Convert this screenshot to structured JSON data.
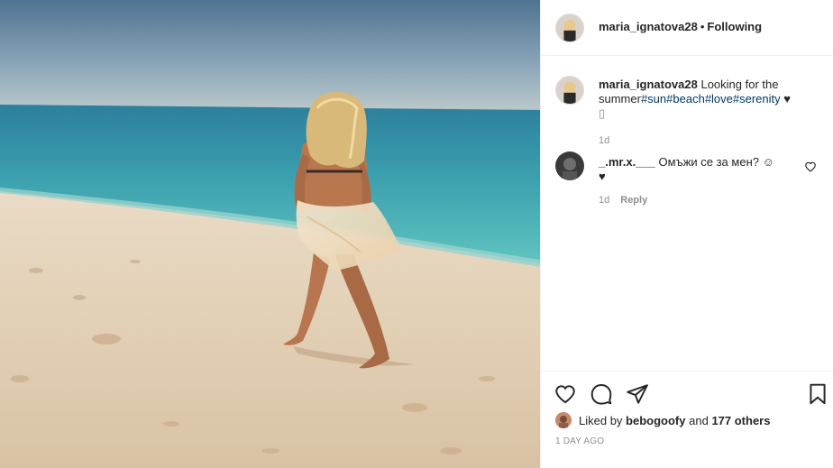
{
  "colors": {
    "text": "#262626",
    "muted": "#8e8e8e",
    "hashtag": "#00376b",
    "border": "#efefef"
  },
  "post": {
    "photo_icon": "beach-photo",
    "header": {
      "username": "maria_ignatova28",
      "separator": "•",
      "follow_status": "Following"
    },
    "caption": {
      "username": "maria_ignatova28",
      "text": "Looking for the summer",
      "hashtags": [
        "#sun",
        "#beach",
        "#love",
        "#serenity"
      ],
      "trailing": "♥",
      "trailing_box": "▯",
      "time": "1d"
    },
    "comments": [
      {
        "username": "_.mr.x.___",
        "text": "Омъжи се за мен? ☺",
        "heart": "♥",
        "time": "1d",
        "reply_label": "Reply",
        "like_icon": "heart-outline-icon"
      }
    ],
    "actions": {
      "like_icon": "heart-outline-icon",
      "comment_icon": "comment-icon",
      "share_icon": "share-icon",
      "save_icon": "bookmark-icon"
    },
    "likes": {
      "prefix": "Liked by",
      "liker": "bebogoofy",
      "middle": "and",
      "others": "177 others"
    },
    "time_ago": "1 DAY AGO"
  }
}
